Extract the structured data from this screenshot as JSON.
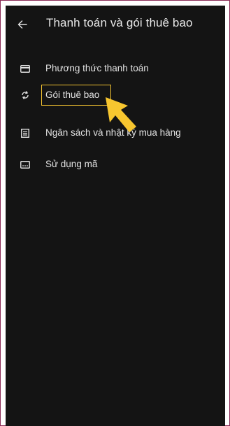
{
  "header": {
    "title": "Thanh toán và gói thuê bao"
  },
  "menu": [
    {
      "label": "Phương thức thanh toán",
      "icon": "credit-card-icon"
    },
    {
      "label": "Gói thuê bao",
      "icon": "sync-icon"
    },
    {
      "label": "Ngân sách và nhật ký mua hàng",
      "icon": "receipt-list-icon"
    },
    {
      "label": "Sử dụng mã",
      "icon": "redeem-code-icon"
    }
  ],
  "colors": {
    "background": "#141414",
    "text": "#e3e3e3",
    "highlight": "#f2c230",
    "pointer": "#f7c62f"
  }
}
